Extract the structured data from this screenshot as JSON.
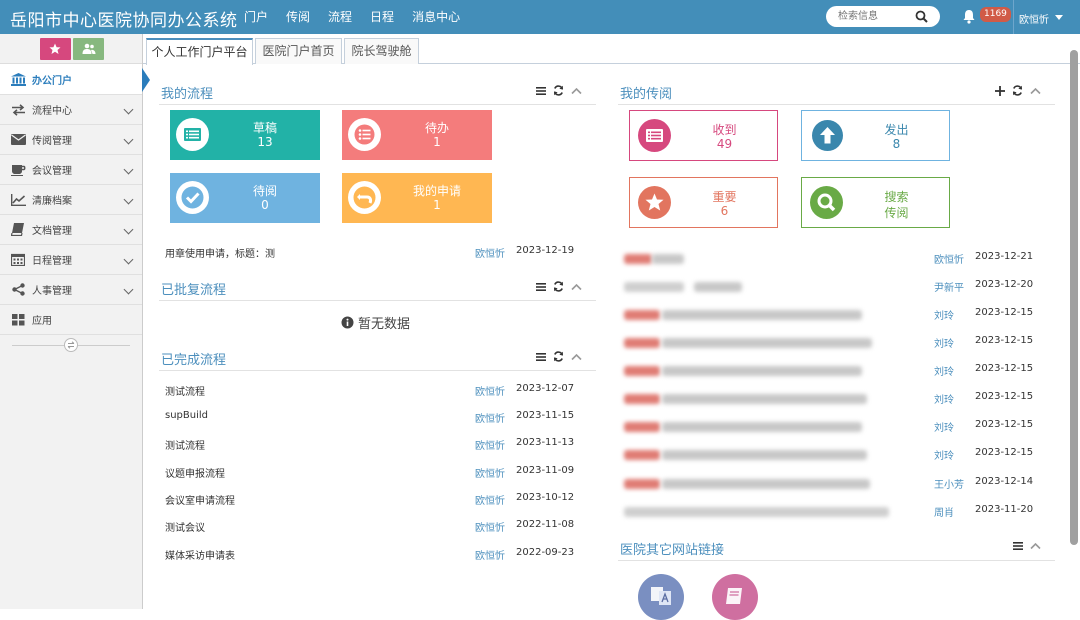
{
  "app": {
    "title": "岳阳市中心医院协同办公系统"
  },
  "topnav": {
    "items": [
      "门户",
      "传阅",
      "流程",
      "日程",
      "消息中心"
    ]
  },
  "search": {
    "placeholder": "检索信息"
  },
  "notifications": {
    "count": "1169"
  },
  "user": {
    "name": "欧恒忻"
  },
  "sidebar": {
    "items": [
      {
        "label": "办公门户",
        "icon": "bank-icon",
        "active": true
      },
      {
        "label": "流程中心",
        "icon": "exchange-icon"
      },
      {
        "label": "传阅管理",
        "icon": "envelope-icon"
      },
      {
        "label": "会议管理",
        "icon": "coffee-icon"
      },
      {
        "label": "清廉档案",
        "icon": "line-chart-icon"
      },
      {
        "label": "文档管理",
        "icon": "book-icon"
      },
      {
        "label": "日程管理",
        "icon": "calendar-icon"
      },
      {
        "label": "人事管理",
        "icon": "share-icon"
      },
      {
        "label": "应用",
        "icon": "grid-icon"
      }
    ]
  },
  "tabs": [
    {
      "label": "个人工作门户平台",
      "active": true
    },
    {
      "label": "医院门户首页"
    },
    {
      "label": "院长驾驶舱"
    }
  ],
  "my_flow": {
    "title": "我的流程",
    "tiles": [
      {
        "label": "草稿",
        "count": "13",
        "color": "#22b2a7"
      },
      {
        "label": "待办",
        "count": "1",
        "color": "#f47c7c"
      },
      {
        "label": "待阅",
        "count": "0",
        "color": "#6fb3e0"
      },
      {
        "label": "我的申请",
        "count": "1",
        "color": "#ffb752"
      }
    ],
    "recent": {
      "title": "用章使用申请，标题：测",
      "user": "欧恒忻",
      "date": "2023-12-19"
    }
  },
  "approved_flow": {
    "title": "已批复流程",
    "empty_text": "暂无数据"
  },
  "done_flow": {
    "title": "已完成流程",
    "rows": [
      {
        "title": "测试流程",
        "user": "欧恒忻",
        "date": "2023-12-07"
      },
      {
        "title": "supBuild",
        "user": "欧恒忻",
        "date": "2023-11-15"
      },
      {
        "title": "测试流程",
        "user": "欧恒忻",
        "date": "2023-11-13"
      },
      {
        "title": "议题申报流程",
        "user": "欧恒忻",
        "date": "2023-11-09"
      },
      {
        "title": "会议室申请流程",
        "user": "欧恒忻",
        "date": "2023-10-12"
      },
      {
        "title": "测试会议",
        "user": "欧恒忻",
        "date": "2022-11-08"
      },
      {
        "title": "媒体采访申请表",
        "user": "欧恒忻",
        "date": "2022-09-23"
      }
    ]
  },
  "my_circulation": {
    "title": "我的传阅",
    "tiles": [
      {
        "label": "收到",
        "count": "49",
        "color": "#d6487e"
      },
      {
        "label": "发出",
        "count": "8",
        "color": "#3a87ad"
      },
      {
        "label": "重要",
        "count": "6",
        "color": "#e2755f"
      },
      {
        "label": "搜索",
        "count": "传阅",
        "color": "#69aa46"
      }
    ],
    "rows": [
      {
        "user": "欧恒忻",
        "date": "2023-12-21"
      },
      {
        "user": "尹新平",
        "date": "2023-12-20"
      },
      {
        "user": "刘玲",
        "date": "2023-12-15"
      },
      {
        "user": "刘玲",
        "date": "2023-12-15"
      },
      {
        "user": "刘玲",
        "date": "2023-12-15"
      },
      {
        "user": "刘玲",
        "date": "2023-12-15"
      },
      {
        "user": "刘玲",
        "date": "2023-12-15"
      },
      {
        "user": "刘玲",
        "date": "2023-12-15"
      },
      {
        "user": "王小芳",
        "date": "2023-12-14"
      },
      {
        "user": "周肖",
        "date": "2023-11-20"
      }
    ]
  },
  "hospital_links": {
    "title": "医院其它网站链接"
  }
}
